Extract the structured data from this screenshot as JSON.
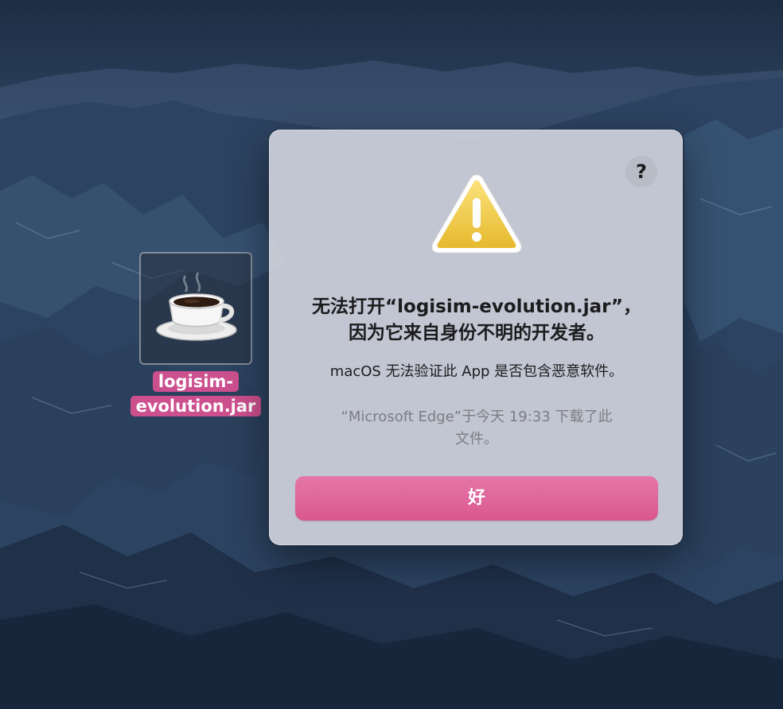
{
  "desktop": {
    "file": {
      "name_line1": "logisim-",
      "name_line2": "evolution.jar",
      "icon": "java-coffee-cup-icon"
    }
  },
  "dialog": {
    "help_label": "?",
    "icon": "warning-triangle-icon",
    "title_line1": "无法打开“logisim-evolution.jar”，",
    "title_line2": "因为它来自身份不明的开发者。",
    "message": "macOS 无法验证此 App 是否包含恶意软件。",
    "info_line1": "“Microsoft Edge”于今天 19:33 下载了此",
    "info_line2": "文件。",
    "ok_label": "好"
  },
  "colors": {
    "accent": "#d9578f",
    "selection": "#cc4f8e",
    "warning": "#f0cc3c"
  }
}
